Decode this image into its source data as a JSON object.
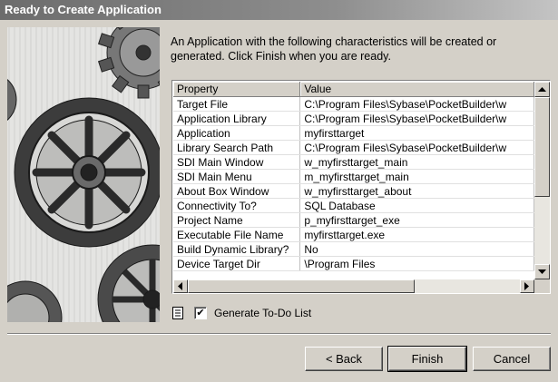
{
  "window": {
    "title": "Ready to Create Application"
  },
  "intro_text": "An Application with the following characteristics will be created or generated.  Click Finish when you are ready.",
  "table": {
    "columns": [
      "Property",
      "Value"
    ],
    "rows": [
      [
        "Target File",
        "C:\\Program Files\\Sybase\\PocketBuilder\\w"
      ],
      [
        "Application Library",
        "C:\\Program Files\\Sybase\\PocketBuilder\\w"
      ],
      [
        "Application",
        "myfirsttarget"
      ],
      [
        "Library Search Path",
        "C:\\Program Files\\Sybase\\PocketBuilder\\w"
      ],
      [
        "SDI Main Window",
        "w_myfirsttarget_main"
      ],
      [
        "SDI Main Menu",
        "m_myfirsttarget_main"
      ],
      [
        "About Box Window",
        "w_myfirsttarget_about"
      ],
      [
        "Connectivity To?",
        "SQL Database"
      ],
      [
        "Project Name",
        "p_myfirsttarget_exe"
      ],
      [
        "Executable File Name",
        "myfirsttarget.exe"
      ],
      [
        "Build Dynamic Library?",
        "No"
      ],
      [
        "Device Target Dir",
        "\\Program Files"
      ]
    ]
  },
  "todo": {
    "label": "Generate To-Do List",
    "checked": true,
    "icon": "todo-list-icon"
  },
  "buttons": {
    "back": "< Back",
    "finish": "Finish",
    "cancel": "Cancel"
  },
  "colors": {
    "dialog_bg": "#d4d0c8",
    "titlebar": "#6c6c6c"
  }
}
